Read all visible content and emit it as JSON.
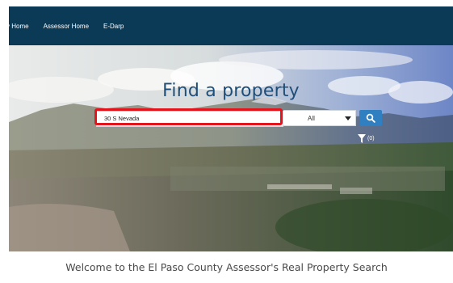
{
  "nav": {
    "items": [
      {
        "label": "y Home"
      },
      {
        "label": "Assessor Home"
      },
      {
        "label": "E-Darp"
      }
    ]
  },
  "hero": {
    "title": "Find a property"
  },
  "search": {
    "value": "30 S Nevada",
    "select_value": "All"
  },
  "filter": {
    "count_label": "(0)"
  },
  "footer": {
    "welcome": "Welcome to the El Paso County Assessor's Real Property Search"
  },
  "colors": {
    "navbar": "#0b3a57",
    "accent": "#2f7fc1",
    "highlight": "#e3141b",
    "title": "#1f4e79"
  },
  "icons": {
    "search": "search-icon",
    "filter": "funnel-icon",
    "dropdown": "chevron-down-icon"
  }
}
